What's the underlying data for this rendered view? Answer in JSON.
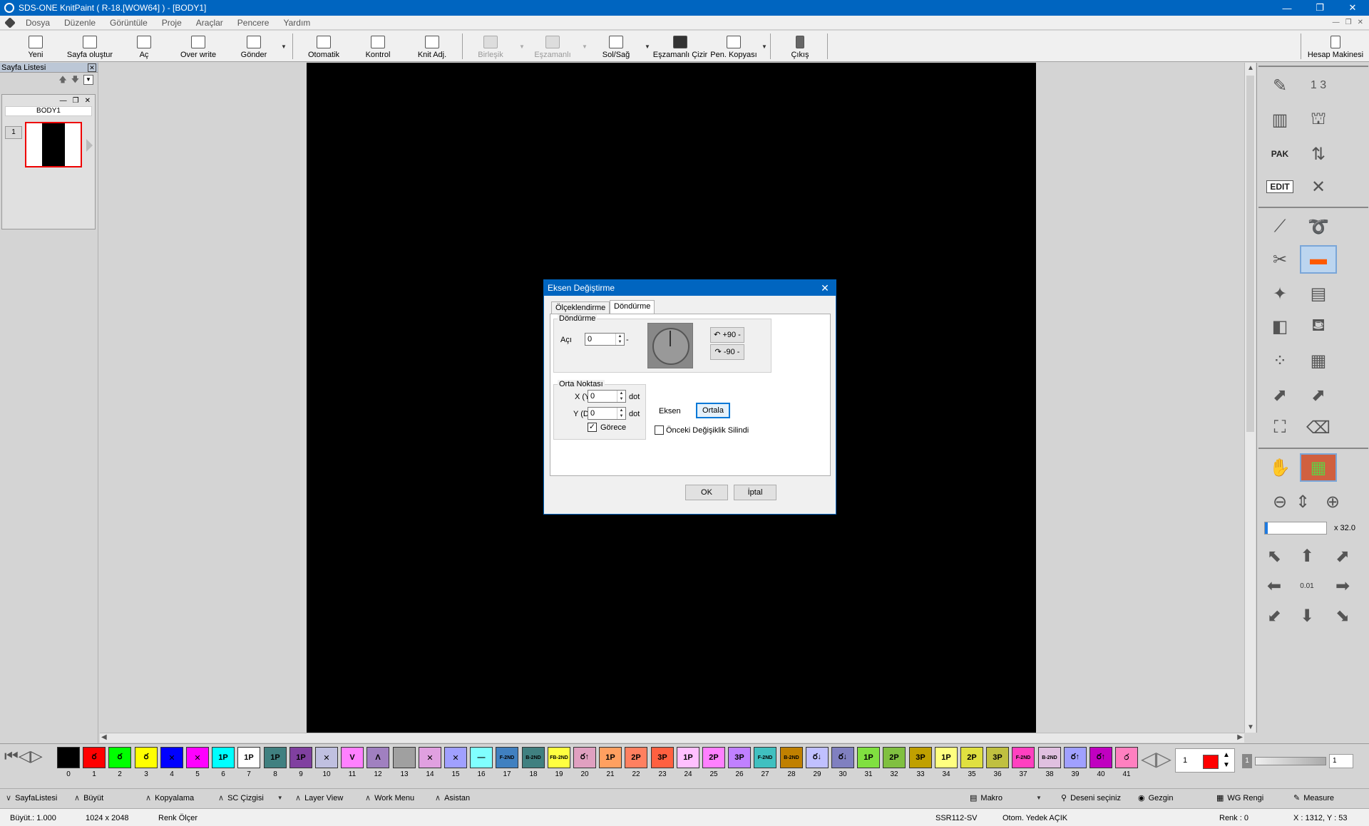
{
  "window": {
    "title": "SDS-ONE KnitPaint ( R-18.[WOW64] ) - [BODY1]",
    "min": "—",
    "restore": "❐",
    "close": "✕"
  },
  "menu": {
    "items": [
      "Dosya",
      "Düzenle",
      "Görüntüle",
      "Proje",
      "Araçlar",
      "Pencere",
      "Yardım"
    ]
  },
  "toolbar": {
    "buttons": [
      {
        "label": "Yeni",
        "enabled": true
      },
      {
        "label": "Sayfa oluştur",
        "enabled": true
      },
      {
        "label": "Aç",
        "enabled": true
      },
      {
        "label": "Over write",
        "enabled": true
      },
      {
        "label": "Gönder",
        "enabled": true
      },
      {
        "label": "Otomatik",
        "enabled": true
      },
      {
        "label": "Kontrol",
        "enabled": true
      },
      {
        "label": "Knit Adj.",
        "enabled": true
      },
      {
        "label": "Birleşik",
        "enabled": false
      },
      {
        "label": "Eşzamanlı",
        "enabled": false
      },
      {
        "label": "Sol/Sağ",
        "enabled": true
      },
      {
        "label": "Eşzamanlı Çizir",
        "enabled": true
      },
      {
        "label": "Pen. Kopyası",
        "enabled": true
      },
      {
        "label": "Çıkış",
        "enabled": true
      },
      {
        "label": "Hesap Makinesi",
        "enabled": true
      }
    ]
  },
  "sidebar": {
    "title": "Sayfa Listesi",
    "page_name": "BODY1",
    "page_number": "1"
  },
  "dialog": {
    "title": "Eksen Değiştirme",
    "tabs": [
      "Ölçeklendirme",
      "Döndürme"
    ],
    "active_tab": "Döndürme",
    "rotation_group": "Döndürme",
    "angle_label": "Açı",
    "angle_value": "0",
    "angle_suffix": "-",
    "btn_plus90": "+90 -",
    "btn_minus90": "-90 -",
    "center_group": "Orta Noktası",
    "x_label": "X (Y)",
    "x_value": "0",
    "y_label": "Y (D)",
    "y_value": "0",
    "unit": "dot",
    "relative_label": "Görece",
    "relative_checked": true,
    "axis_label": "Eksen",
    "center_button": "Ortala",
    "clear_prev_label": "Önceki Değişiklik Silindi",
    "clear_prev_checked": false,
    "ok": "OK",
    "cancel": "İptal"
  },
  "palette": {
    "edit_label": "EDIT",
    "pak_label": "PAK",
    "zoom": "x 32.0",
    "zoom_fraction": 0.05,
    "step_label": "0.01"
  },
  "colors": [
    {
      "n": "0",
      "hex": "#000000",
      "t": ""
    },
    {
      "n": "1",
      "hex": "#ff0000",
      "t": "ర"
    },
    {
      "n": "2",
      "hex": "#00ff00",
      "t": "ర"
    },
    {
      "n": "3",
      "hex": "#ffff00",
      "t": "ర"
    },
    {
      "n": "4",
      "hex": "#0000ff",
      "t": "✕"
    },
    {
      "n": "5",
      "hex": "#ff00ff",
      "t": "✕"
    },
    {
      "n": "6",
      "hex": "#00ffff",
      "t": "1P"
    },
    {
      "n": "7",
      "hex": "#ffffff",
      "t": "1P"
    },
    {
      "n": "8",
      "hex": "#408080",
      "t": "1P"
    },
    {
      "n": "9",
      "hex": "#8040a0",
      "t": "1P"
    },
    {
      "n": "10",
      "hex": "#c0c0e0",
      "t": "✕"
    },
    {
      "n": "11",
      "hex": "#ff80ff",
      "t": "V"
    },
    {
      "n": "12",
      "hex": "#a080c0",
      "t": "Λ"
    },
    {
      "n": "13",
      "hex": "#a0a0a0",
      "t": ""
    },
    {
      "n": "14",
      "hex": "#e0a0e0",
      "t": "✕"
    },
    {
      "n": "15",
      "hex": "#a0a0ff",
      "t": "✕"
    },
    {
      "n": "16",
      "hex": "#80ffff",
      "t": "—"
    },
    {
      "n": "17",
      "hex": "#4080c0",
      "t": "F-2ND"
    },
    {
      "n": "18",
      "hex": "#408080",
      "t": "B-2ND"
    },
    {
      "n": "19",
      "hex": "#ffff40",
      "t": "FB-2ND"
    },
    {
      "n": "20",
      "hex": "#e0a0c0",
      "t": "ర↑"
    },
    {
      "n": "21",
      "hex": "#ffa060",
      "t": "1P"
    },
    {
      "n": "22",
      "hex": "#ff8060",
      "t": "2P"
    },
    {
      "n": "23",
      "hex": "#ff6040",
      "t": "3P"
    },
    {
      "n": "24",
      "hex": "#ffc0ff",
      "t": "1P"
    },
    {
      "n": "25",
      "hex": "#ff80ff",
      "t": "2P"
    },
    {
      "n": "26",
      "hex": "#c080ff",
      "t": "3P"
    },
    {
      "n": "27",
      "hex": "#40c0c0",
      "t": "F-2ND"
    },
    {
      "n": "28",
      "hex": "#c08000",
      "t": "B-2ND"
    },
    {
      "n": "29",
      "hex": "#c0c0ff",
      "t": "ర↓"
    },
    {
      "n": "30",
      "hex": "#8080c0",
      "t": "ర↓"
    },
    {
      "n": "31",
      "hex": "#80e040",
      "t": "1P"
    },
    {
      "n": "32",
      "hex": "#80c040",
      "t": "2P"
    },
    {
      "n": "33",
      "hex": "#c0a000",
      "t": "3P"
    },
    {
      "n": "34",
      "hex": "#ffff80",
      "t": "1P"
    },
    {
      "n": "35",
      "hex": "#e0e040",
      "t": "2P"
    },
    {
      "n": "36",
      "hex": "#c0c040",
      "t": "3P"
    },
    {
      "n": "37",
      "hex": "#ff40c0",
      "t": "F-2ND"
    },
    {
      "n": "38",
      "hex": "#e0c0e0",
      "t": "B-2ND"
    },
    {
      "n": "39",
      "hex": "#a0a0ff",
      "t": "ర↑"
    },
    {
      "n": "40",
      "hex": "#c000c0",
      "t": "ర↑"
    },
    {
      "n": "41",
      "hex": "#ff80c0",
      "t": "ර"
    }
  ],
  "color_selector": {
    "value": "1",
    "swatch": "#ff0000",
    "slider_label": "1",
    "slider_value": "1"
  },
  "bottomtools": {
    "items": [
      "SayfaListesi",
      "Büyüt",
      "Kopyalama",
      "SC Çizgisi",
      "Layer View",
      "Work Menu",
      "Asistan"
    ],
    "makro": "Makro",
    "deseni": "Deseni seçiniz",
    "gezgin": "Gezgin",
    "wg": "WG Rengi",
    "measure": "Measure"
  },
  "status": {
    "zoom": "Büyüt.: 1.000",
    "size": "1024 x 2048",
    "meter": "Renk Ölçer",
    "machine": "SSR112-SV",
    "backup": "Otom. Yedek AÇIK",
    "color": "Renk : 0",
    "coords": "X : 1312, Y : 53"
  }
}
